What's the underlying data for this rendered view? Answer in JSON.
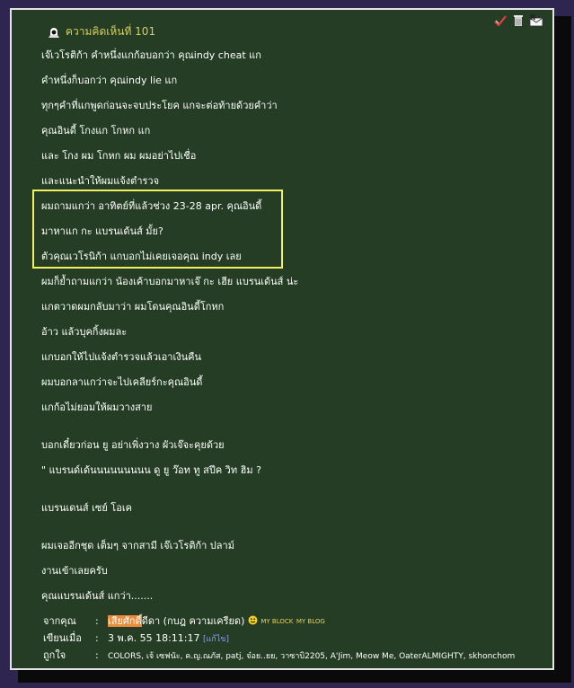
{
  "header": {
    "title": "ความคิดเห็นที่ 101"
  },
  "icons": {
    "avatar": "hooded-figure-icon",
    "vote": "check-icon",
    "delete": "trash-icon",
    "reply": "reply-icon"
  },
  "messages": [
    "เจ๊เวโรติก้า คำหนึ่งแกก้อบอกว่า คุณindy cheat แก",
    "คำหนึ่งก็บอกว่า คุณindy lie แก",
    "ทุกๆคำที่แกพูดก่อนจะจบประโยค แกจะต่อท้ายด้วยคำว่า",
    "คุณอินดี้ โกงแก โกหก แก",
    "และ โกง ผม โกหก ผม ผมอย่าไปเชื่อ",
    "และแนะนำให้ผมแจ้งตำรวจ",
    "ผมถามแกว่า อาทิตย์ที่แล้วช่วง 23-28 apr. คุณอินดี้",
    "มาหาแก กะ แบรนเด้นส์ มั้ย?",
    "ตัวคุณเวโรนิก้า แกบอกไม่เคยเจอคุณ indy เลย",
    "ผมก็ย้ำถามแกว่า น้องเค้าบอกมาหาเจ๊ กะ เฮีย แบรนเด้นส์ น่ะ",
    "แกตวาดผมกลับมาว่า ผมโดนคุณอินดี้โกหก",
    "อ้าว แล้วบุคกิ้งผมละ",
    "แกบอกให้ไปแจ้งตำรวจแล้วเอาเงินคืน",
    "ผมบอกลาแกว่าจะไปเคลียร์กะคุณอินดี้",
    "แกก้อไม่ยอมให้ผมวางสาย",
    "บอกเดี๋ยวก่อน ยู อย่าเพิ่งวาง ผัวเจ๊จะคุยด้วย",
    "\" แบรนด์เด้นนนนนนนนน ดู ยู ว๊อท ทู สปีค วิท ฮิม ?",
    "แบรนเดนส์ เซย์   โอเค",
    "ผมเจออีกชุด เต็มๆ จากสามี เจ๊เวโรติก้า ปลาม์",
    "งานเข้าเลยครับ",
    "คุณแบรนเด้นส์ แกว่า......."
  ],
  "meta": {
    "from_label": "จากคุณ",
    "from_highlight": "เสียศักดิ์",
    "from_rest": "ดีดา (กบฎ ความเครียด)",
    "my_block": "MY BLOCK",
    "my_blog": "MY BLOG",
    "written_label": "เขียนเมื่อ",
    "written_value": "3 พ.ค. 55 18:11:17",
    "edit_label": "[แก้ไข]",
    "likes_label": "ถูกใจ",
    "likes_value": "COLORS, เจ้ เซฟนัะ, ค.ญ.ณภัส, patj, จ๋อย..ยย, วาซาบิ2205, A'Jim, Meow Me, OaterALMIGHTY, skhonchom"
  },
  "colors": {
    "background": "#2e2650",
    "panel": "#243d24",
    "title": "#d4d060",
    "highlight_border": "#f0f060",
    "author_highlight": "#e88a3a"
  }
}
